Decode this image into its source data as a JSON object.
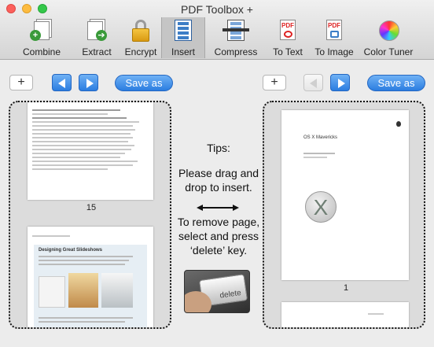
{
  "window": {
    "title": "PDF Toolbox +"
  },
  "toolbar": {
    "items": [
      {
        "label": "Combine",
        "icon": "combine-icon"
      },
      {
        "label": "Extract",
        "icon": "extract-icon"
      },
      {
        "label": "Encrypt",
        "icon": "lock-icon"
      },
      {
        "label": "Insert",
        "icon": "insert-icon",
        "active": true
      },
      {
        "label": "Compress",
        "icon": "compress-icon"
      },
      {
        "label": "To Text",
        "icon": "pdf-to-text-icon"
      },
      {
        "label": "To Image",
        "icon": "pdf-to-image-icon"
      },
      {
        "label": "Color Tuner",
        "icon": "color-wheel-icon"
      }
    ]
  },
  "left_controls": {
    "add_label": "+",
    "save_label": "Save as"
  },
  "right_controls": {
    "add_label": "+",
    "save_label": "Save as",
    "prev_disabled": true
  },
  "left_panel": {
    "pages": [
      {
        "number": "15"
      }
    ],
    "second_page_heading": "Designing Great Slideshows"
  },
  "right_panel": {
    "pages": [
      {
        "number": "1",
        "title": "OS X Mavericks"
      }
    ]
  },
  "tips": {
    "heading": "Tips:",
    "insert_text": "Please drag and drop to insert.",
    "remove_text": "To remove page, select and press ‘delete’ key.",
    "key_label": "delete"
  },
  "colors": {
    "accent": "#2b7de0",
    "close": "#fc605c",
    "minimize": "#fdbc40",
    "zoom": "#34c84a"
  }
}
